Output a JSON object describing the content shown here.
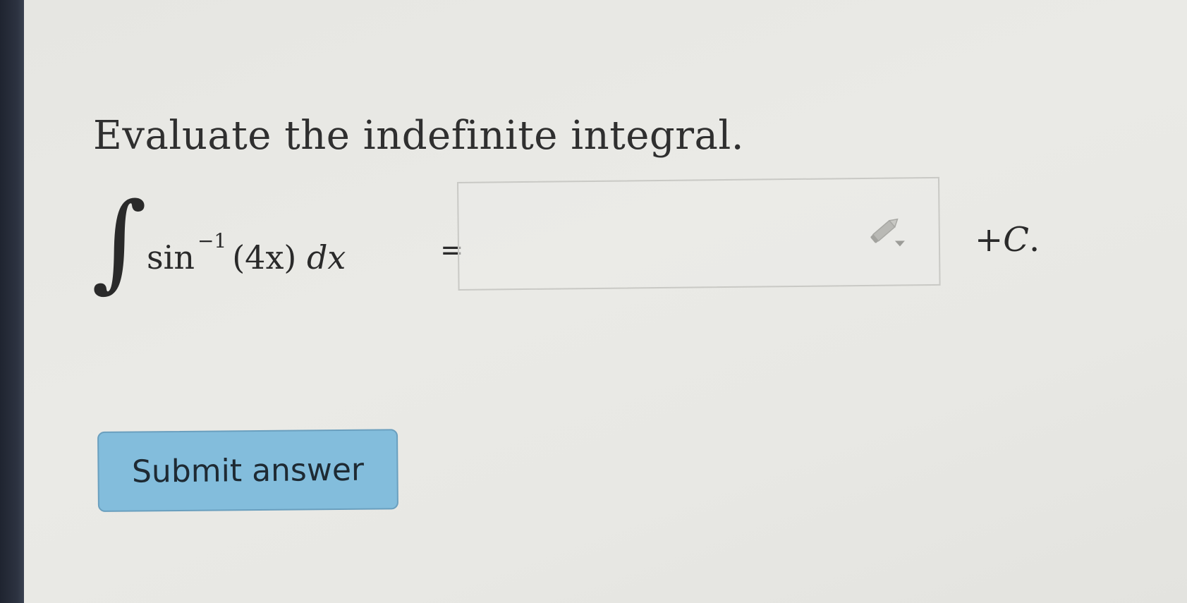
{
  "question": {
    "prompt": "Evaluate the indefinite integral."
  },
  "equation": {
    "integral_symbol": "∫",
    "function_name": "sin",
    "exponent": "−1",
    "argument": "(4x)",
    "differential": "dx",
    "equals": "=",
    "constant_prefix": "+",
    "constant_var": "C",
    "constant_suffix": "."
  },
  "answer": {
    "value": "",
    "placeholder": ""
  },
  "icons": {
    "input_tool": "pencil-dropdown-icon"
  },
  "submit": {
    "label": "Submit answer"
  },
  "colors": {
    "button_bg": "#83bddc",
    "button_border": "#6a9fbe",
    "box_border": "#c9c9c5",
    "text": "#2a2a2a"
  }
}
